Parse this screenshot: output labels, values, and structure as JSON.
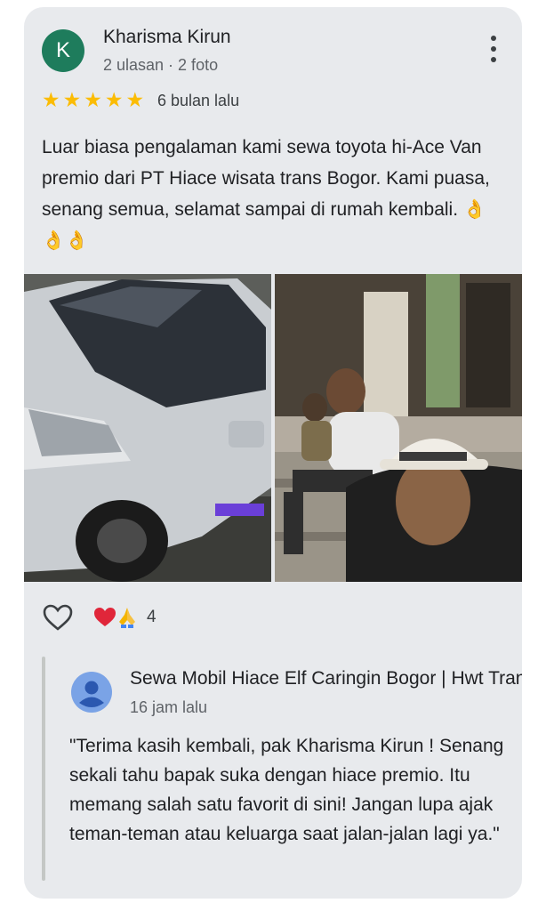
{
  "review": {
    "author_initial": "K",
    "author_name": "Kharisma Kirun",
    "author_meta": "2 ulasan · 2 foto",
    "rating": 5,
    "time": "6 bulan lalu",
    "text": "Luar biasa pengalaman kami sewa toyota hi-Ace Van premio dari PT Hiace wisata trans Bogor. Kami puasa, senang semua, selamat sampai di rumah kembali. 👌👌👌",
    "reaction_count": "4"
  },
  "colors": {
    "avatar_bg": "#1e7c5c",
    "star": "#fbbc04",
    "card_bg": "#e8eaed",
    "owner_avatar": "#7aa3e6"
  },
  "icons": [
    "more-vert-icon",
    "star-icon",
    "heart-outline-icon",
    "heart-emoji",
    "pray-emoji",
    "person-icon"
  ],
  "owner_reply": {
    "name": "Sewa Mobil Hiace Elf Caringin Bogor | Hwt Trans",
    "time": "16 jam lalu",
    "text": "\"Terima kasih kembali, pak Kharisma Kirun ! Senang sekali tahu bapak suka dengan hiace premio. Itu memang salah satu favorit di sini! Jangan lupa ajak teman-teman atau keluarga saat jalan-jalan lagi ya.\""
  }
}
